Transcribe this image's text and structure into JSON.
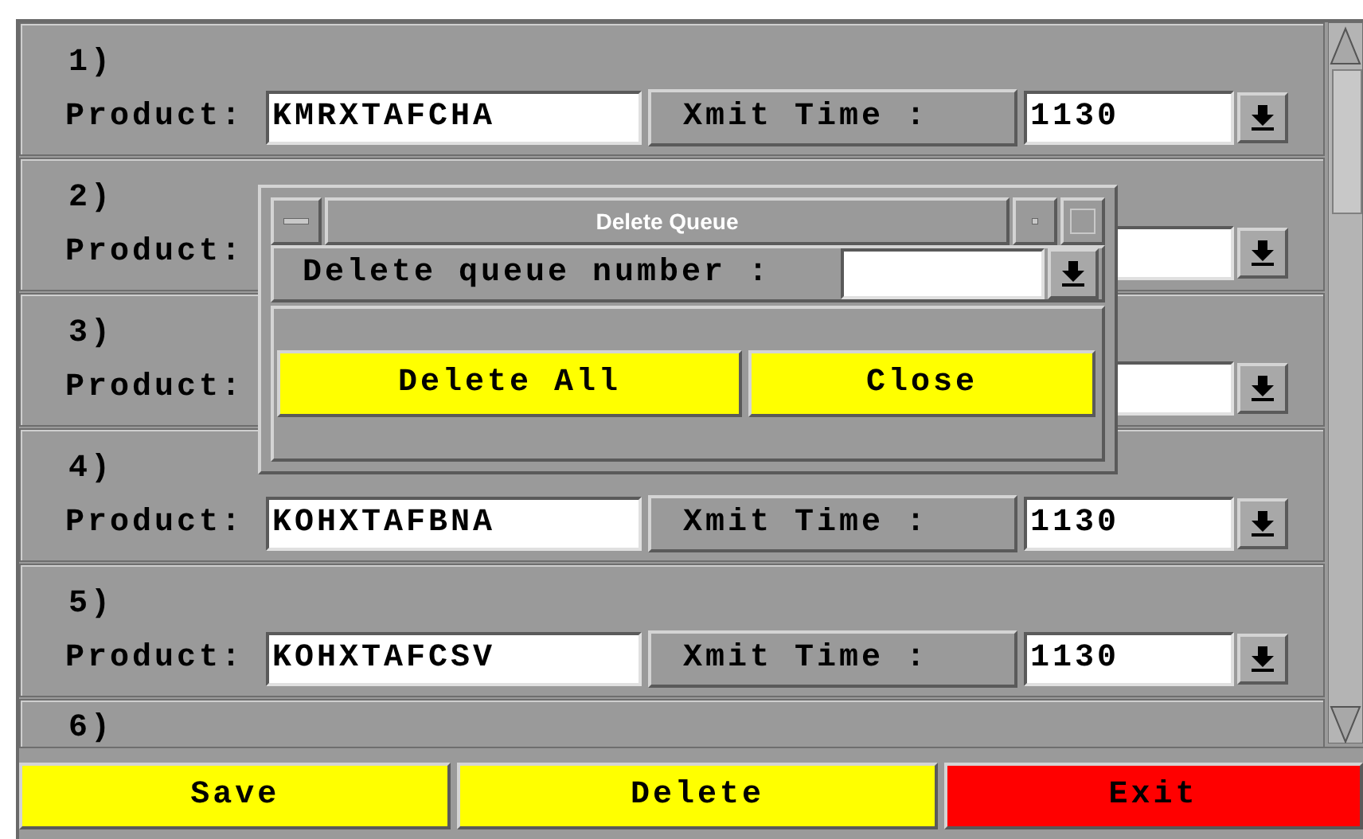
{
  "rows": [
    {
      "kind": "full",
      "number": "1)",
      "product_label": "Product:",
      "product": "KMRXTAFCHA",
      "time_label": "Xmit Time :",
      "time": "1130"
    },
    {
      "kind": "covered",
      "number": "2)",
      "product_label": "Product:"
    },
    {
      "kind": "covered",
      "number": "3)",
      "product_label": "Product:"
    },
    {
      "kind": "full",
      "number": "4)",
      "product_label": "Product:",
      "product": "KOHXTAFBNA",
      "time_label": "Xmit Time :",
      "time": "1130"
    },
    {
      "kind": "full",
      "number": "5)",
      "product_label": "Product:",
      "product": "KOHXTAFCSV",
      "time_label": "Xmit Time :",
      "time": "1130"
    },
    {
      "kind": "cut",
      "number": "6)"
    }
  ],
  "dialog": {
    "title": "Delete Queue",
    "field_label": "Delete queue number :",
    "buttons": [
      "Delete All",
      "Close"
    ]
  },
  "buttons": [
    {
      "label": "Save",
      "color": "#ffff00"
    },
    {
      "label": "Delete",
      "color": "#ffff00"
    },
    {
      "label": "Exit",
      "color": "#ff0000"
    }
  ]
}
